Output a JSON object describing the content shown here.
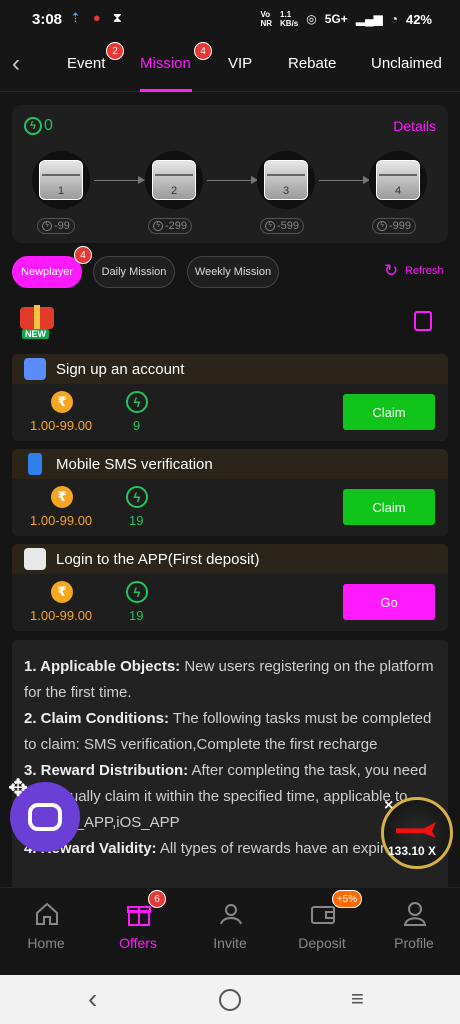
{
  "status": {
    "time": "3:08",
    "net_speed": "1.1\nKB/s",
    "network": "5G+",
    "battery": "42%"
  },
  "topnav": {
    "tabs": [
      {
        "label": "Event",
        "badge": "2"
      },
      {
        "label": "Mission",
        "badge": "4"
      },
      {
        "label": "VIP"
      },
      {
        "label": "Rebate"
      },
      {
        "label": "Unclaimed"
      }
    ]
  },
  "progress": {
    "points": "0",
    "details_label": "Details",
    "chests": [
      {
        "num": "1",
        "cost": "-99"
      },
      {
        "num": "2",
        "cost": "-299"
      },
      {
        "num": "3",
        "cost": "-599"
      },
      {
        "num": "4",
        "cost": "-999"
      }
    ]
  },
  "filters": {
    "newplayer": "Newplayer",
    "newplayer_badge": "4",
    "daily": "Daily Mission",
    "weekly": "Weekly Mission",
    "refresh": "Refresh",
    "new_tag": "NEW"
  },
  "tasks": [
    {
      "title": "Sign up an account",
      "range": "1.00-99.00",
      "points": "9",
      "button": "Claim"
    },
    {
      "title": "Mobile SMS verification",
      "range": "1.00-99.00",
      "points": "19",
      "button": "Claim"
    },
    {
      "title": "Login to the APP(First deposit)",
      "range": "1.00-99.00",
      "points": "19",
      "button": "Go"
    }
  ],
  "rules": {
    "r1_head": "1. Applicable Objects:",
    "r1_body": " New users registering on the platform for the first time.",
    "r2_head": "2. Claim Conditions:",
    "r2_body": " The following tasks must be completed to claim: SMS verification,Complete the first recharge",
    "r3_head": "3. Reward Distribution:",
    "r3_body": " After completing the task, you need to manually claim it within the specified time, applicable to Android_APP,iOS_APP",
    "r4_head": "4. Reward Validity:",
    "r4_body": " All types of rewards have an expiration"
  },
  "game_fab": {
    "multiplier": "133.10 X"
  },
  "tabbar": {
    "items": [
      {
        "label": "Home"
      },
      {
        "label": "Offers",
        "badge": "6"
      },
      {
        "label": "Invite"
      },
      {
        "label": "Deposit",
        "badge": "+5%"
      },
      {
        "label": "Profile"
      }
    ]
  },
  "colors": {
    "accent": "#ff1aff",
    "claim_green": "#10c41a",
    "points_green": "#22c55e",
    "coin": "#f5a623"
  }
}
